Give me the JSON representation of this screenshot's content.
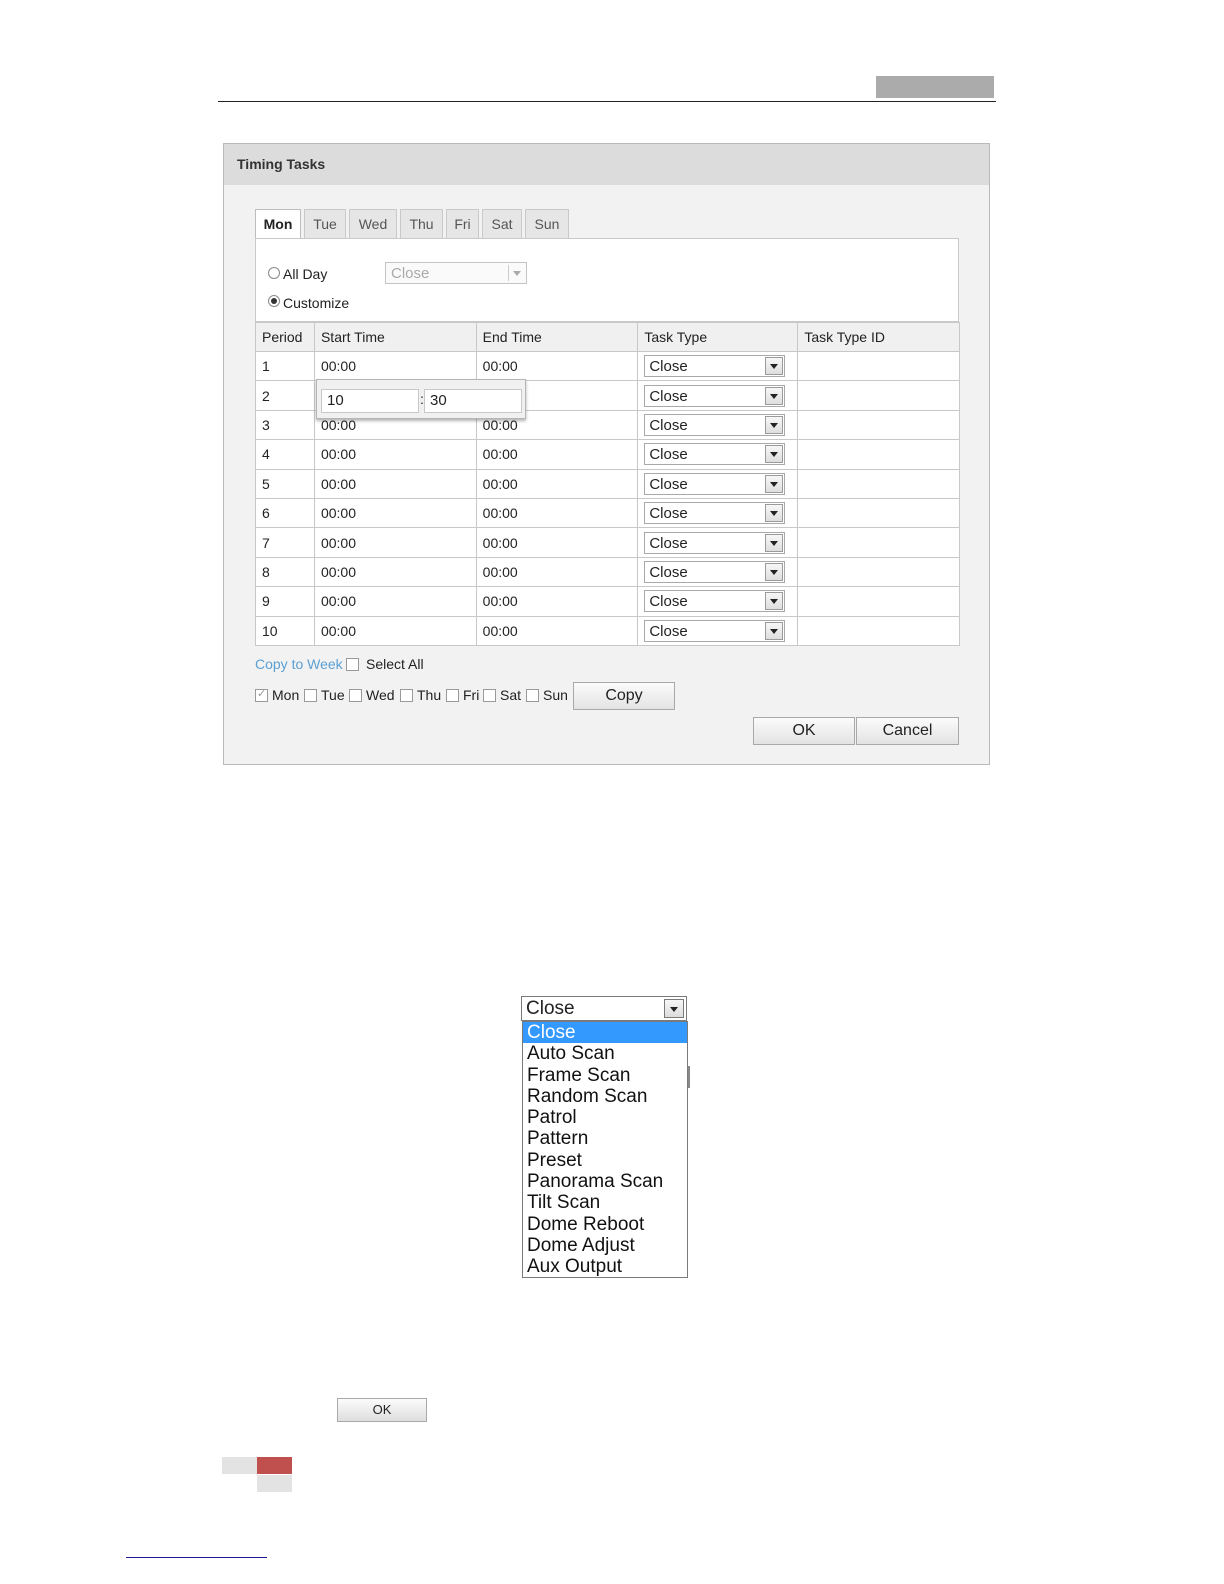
{
  "dialog": {
    "title": "Timing Tasks",
    "tabs": [
      "Mon",
      "Tue",
      "Wed",
      "Thu",
      "Fri",
      "Sat",
      "Sun"
    ],
    "active_tab": "Mon",
    "all_day_label": "All Day",
    "all_day_select": "Close",
    "customize_label": "Customize",
    "selected_mode": "Customize",
    "table": {
      "headers": [
        "Period",
        "Start Time",
        "End Time",
        "Task Type",
        "Task Type ID"
      ],
      "rows": [
        {
          "period": "1",
          "start": "00:00",
          "end": "00:00",
          "task": "Close",
          "task_id": ""
        },
        {
          "period": "2",
          "start": "",
          "end": "",
          "task": "Close",
          "task_id": ""
        },
        {
          "period": "3",
          "start": "00:00",
          "end": "00:00",
          "task": "Close",
          "task_id": ""
        },
        {
          "period": "4",
          "start": "00:00",
          "end": "00:00",
          "task": "Close",
          "task_id": ""
        },
        {
          "period": "5",
          "start": "00:00",
          "end": "00:00",
          "task": "Close",
          "task_id": ""
        },
        {
          "period": "6",
          "start": "00:00",
          "end": "00:00",
          "task": "Close",
          "task_id": ""
        },
        {
          "period": "7",
          "start": "00:00",
          "end": "00:00",
          "task": "Close",
          "task_id": ""
        },
        {
          "period": "8",
          "start": "00:00",
          "end": "00:00",
          "task": "Close",
          "task_id": ""
        },
        {
          "period": "9",
          "start": "00:00",
          "end": "00:00",
          "task": "Close",
          "task_id": ""
        },
        {
          "period": "10",
          "start": "00:00",
          "end": "00:00",
          "task": "Close",
          "task_id": ""
        }
      ]
    },
    "time_popup": {
      "hour": "10",
      "minute": "30",
      "separator": ":"
    },
    "copy_to_week": "Copy to Week",
    "select_all": "Select All",
    "copy_days": [
      {
        "label": "Mon",
        "checked": true
      },
      {
        "label": "Tue",
        "checked": false
      },
      {
        "label": "Wed",
        "checked": false
      },
      {
        "label": "Thu",
        "checked": false
      },
      {
        "label": "Fri",
        "checked": false
      },
      {
        "label": "Sat",
        "checked": false
      },
      {
        "label": "Sun",
        "checked": false
      }
    ],
    "copy_button": "Copy",
    "ok_button": "OK",
    "cancel_button": "Cancel"
  },
  "task_dropdown": {
    "selected": "Close",
    "options": [
      "Close",
      "Auto Scan",
      "Frame Scan",
      "Random Scan",
      "Patrol",
      "Pattern",
      "Preset",
      "Panorama Scan",
      "Tilt Scan",
      "Dome Reboot",
      "Dome Adjust",
      "Aux Output"
    ]
  },
  "ok_small_button": "OK",
  "colors": {
    "link": "#5a9fd4",
    "highlight": "#3399ff",
    "footer_accent": "#c0504d"
  }
}
